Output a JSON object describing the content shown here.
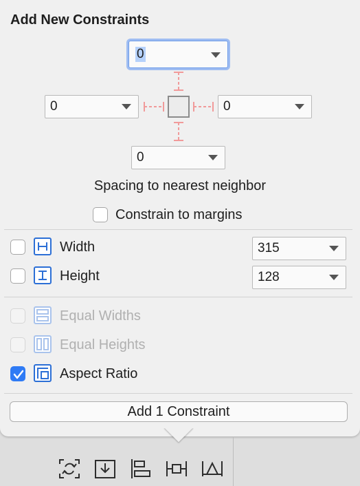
{
  "title": "Add New Constraints",
  "spacing": {
    "top": {
      "value": "0"
    },
    "left": {
      "value": "0"
    },
    "right": {
      "value": "0"
    },
    "bottom": {
      "value": "0"
    },
    "caption": "Spacing to nearest neighbor"
  },
  "constrain_margins": {
    "label": "Constrain to margins",
    "checked": false
  },
  "size": {
    "width": {
      "label": "Width",
      "value": "315",
      "checked": false
    },
    "height": {
      "label": "Height",
      "value": "128",
      "checked": false
    }
  },
  "equal": {
    "widths": {
      "label": "Equal Widths",
      "enabled": false
    },
    "heights": {
      "label": "Equal Heights",
      "enabled": false
    }
  },
  "aspect_ratio": {
    "label": "Aspect Ratio",
    "checked": true
  },
  "add_button": {
    "label": "Add 1 Constraint"
  },
  "colors": {
    "accent": "#2f7bf5",
    "strut": "#f19a9a",
    "icon_blue": "#2c6fd6"
  },
  "toolbar": {
    "icons": [
      "update-frames-icon",
      "embed-in-icon",
      "align-icon",
      "add-constraints-icon",
      "resolve-issues-icon"
    ]
  }
}
